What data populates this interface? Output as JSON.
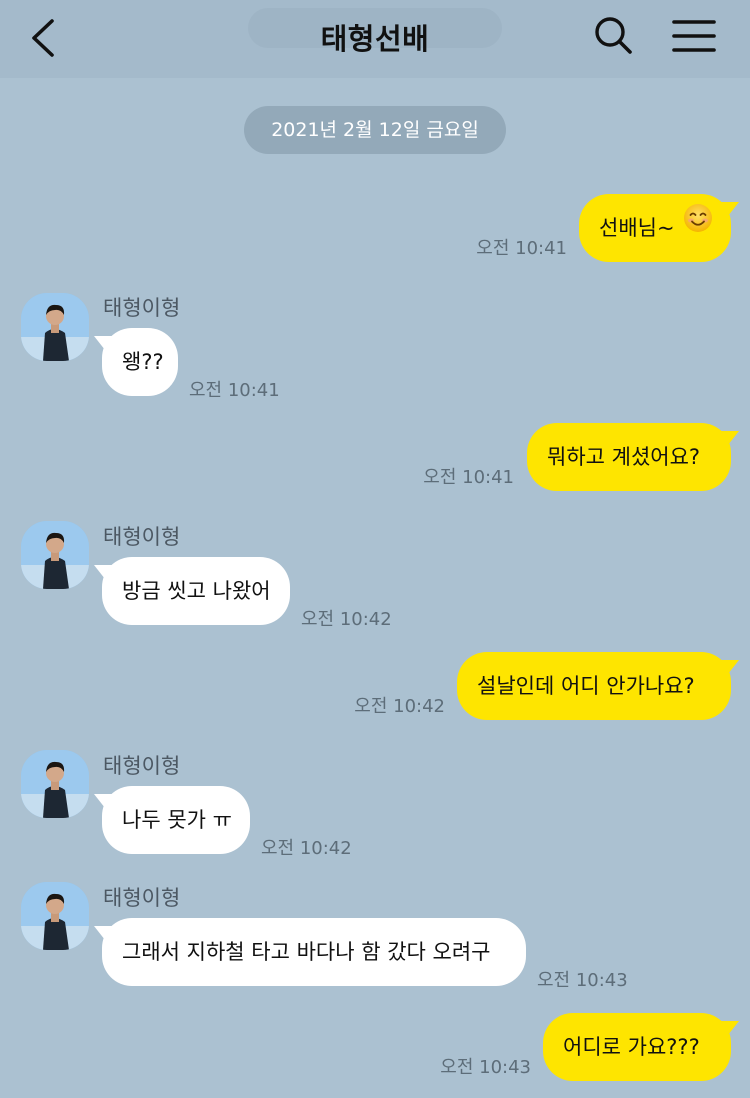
{
  "header": {
    "title": "태형선배"
  },
  "date_divider": "2021년 2월 12일 금요일",
  "messages": [
    {
      "from": "me",
      "text": "선배님~",
      "emoji": "smiling-face-emoji",
      "time": "오전 10:41"
    },
    {
      "from": "them",
      "sender": "태형이형",
      "text": "왱??",
      "time": "오전 10:41"
    },
    {
      "from": "me",
      "text": "뭐하고 계셨어요?",
      "time": "오전 10:41"
    },
    {
      "from": "them",
      "sender": "태형이형",
      "text": "방금 씻고 나왔어",
      "time": "오전 10:42"
    },
    {
      "from": "me",
      "text": "설날인데 어디 안가나요?",
      "time": "오전 10:42"
    },
    {
      "from": "them",
      "sender": "태형이형",
      "text": "나두 못가 ㅠ",
      "time": "오전 10:42"
    },
    {
      "from": "them",
      "sender": "태형이형",
      "text": "그래서 지하철 타고 바다나 함 갔다 오려구",
      "time": "오전 10:43"
    },
    {
      "from": "me",
      "text": "어디로 가요???",
      "time": "오전 10:43"
    }
  ],
  "colors": {
    "background": "#abc1d1",
    "my_bubble": "#fee500",
    "their_bubble": "#ffffff",
    "date_pill": "#93a9b9"
  }
}
